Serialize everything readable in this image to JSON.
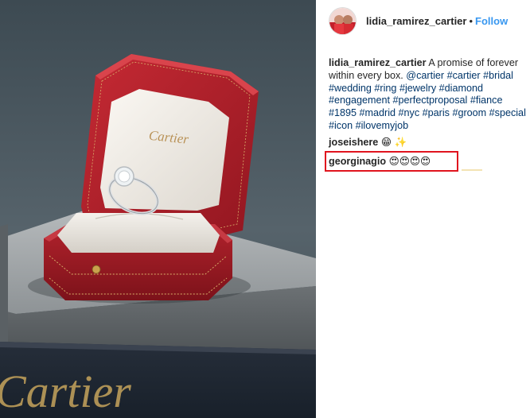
{
  "photo": {
    "alt": "Cartier ring box photo",
    "box_logo": "Cartier",
    "bottom_logo": "Cartier"
  },
  "header": {
    "username": "lidia_ramirez_cartier",
    "separator": "•",
    "follow_label": "Follow"
  },
  "caption": {
    "author": "lidia_ramirez_cartier",
    "text": "A promise of forever within every box.",
    "mention": "@cartier",
    "hashtags": [
      "#cartier",
      "#bridal",
      "#wedding",
      "#ring",
      "#jewelry",
      "#diamond",
      "#engagement",
      "#perfectproposal",
      "#fiance",
      "#1895",
      "#madrid",
      "#nyc",
      "#paris",
      "#groom",
      "#special",
      "#icon",
      "#ilovemyjob"
    ]
  },
  "comments": [
    {
      "user": "joseishere",
      "text": "😁 ✨"
    },
    {
      "user": "georginagio",
      "text": "😍😍😍😍"
    }
  ],
  "colors": {
    "link": "#3897f0",
    "hashtag": "#003569",
    "highlight": "#e0141e",
    "box_red": "#b81e2a"
  }
}
